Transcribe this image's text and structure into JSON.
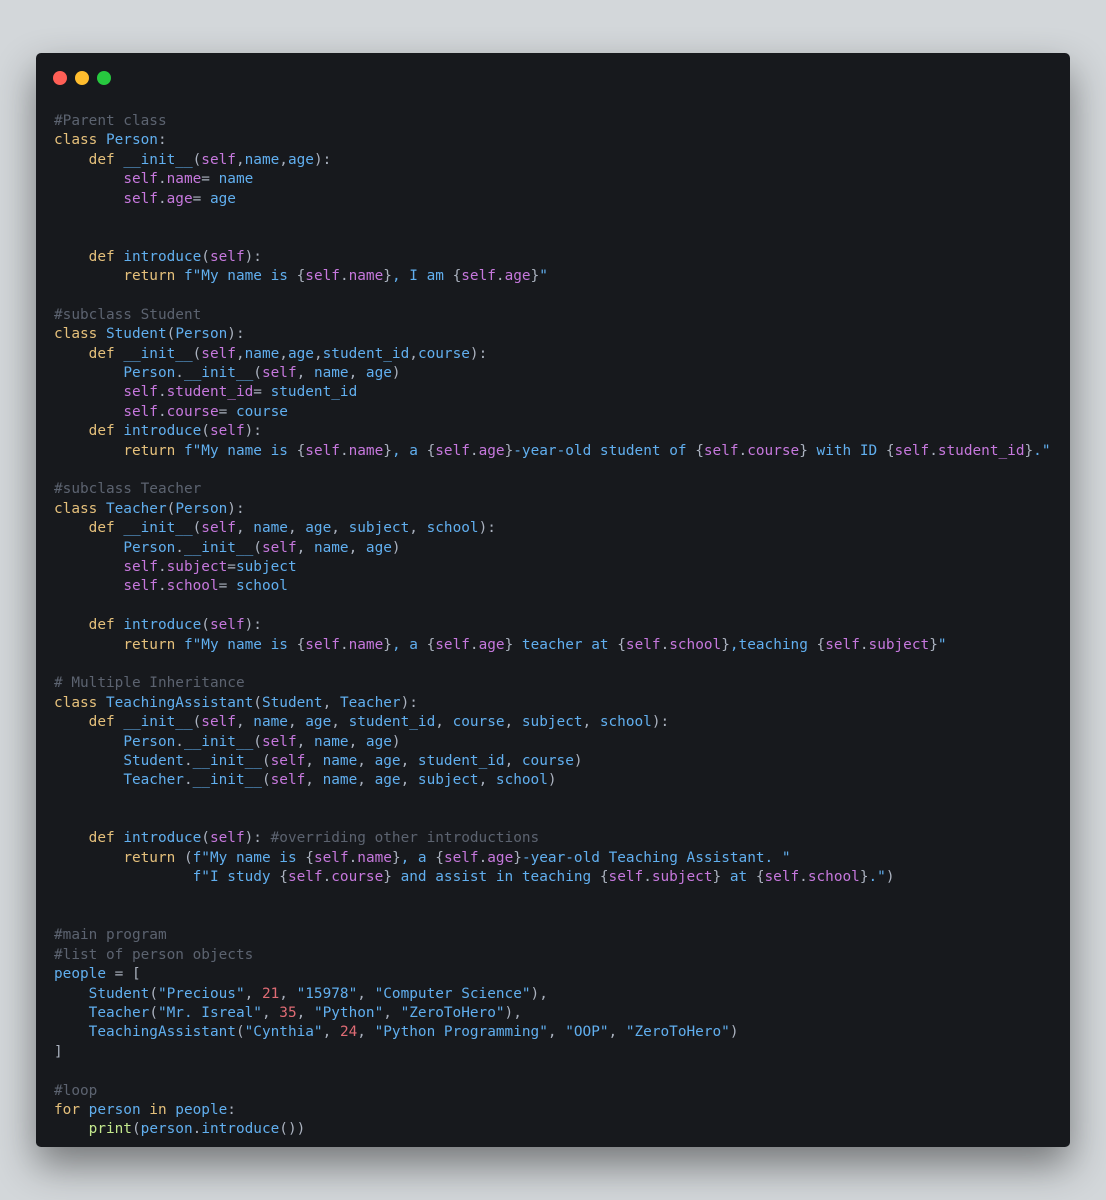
{
  "colors": {
    "background": "#d3d7da",
    "editor_background": "#17191d",
    "traffic_red": "#ff5f56",
    "traffic_yellow": "#ffbd2e",
    "traffic_green": "#27c93f",
    "comment": "#5c6370",
    "keyword": "#e5c07b",
    "identifier": "#61afef",
    "self": "#c678dd",
    "number": "#e06c75",
    "punctuation": "#abb2bf",
    "builtin": "#c3e88d"
  },
  "window_controls": [
    {
      "name": "close",
      "icon": "red-dot-icon"
    },
    {
      "name": "minimize",
      "icon": "yellow-dot-icon"
    },
    {
      "name": "maximize",
      "icon": "green-dot-icon"
    }
  ],
  "code_lines": [
    [
      [
        "comment",
        "#Parent class"
      ]
    ],
    [
      [
        "keyword",
        "class "
      ],
      [
        "classname",
        "Person"
      ],
      [
        "punct",
        ":"
      ]
    ],
    [
      [
        "plain",
        "    "
      ],
      [
        "keyword",
        "def "
      ],
      [
        "func",
        "__init__"
      ],
      [
        "punct",
        "("
      ],
      [
        "self",
        "self"
      ],
      [
        "punct",
        ","
      ],
      [
        "param",
        "name"
      ],
      [
        "punct",
        ","
      ],
      [
        "param",
        "age"
      ],
      [
        "punct",
        "):"
      ]
    ],
    [
      [
        "plain",
        "        "
      ],
      [
        "self",
        "self"
      ],
      [
        "punct",
        "."
      ],
      [
        "self",
        "name"
      ],
      [
        "punct",
        "= "
      ],
      [
        "param",
        "name"
      ]
    ],
    [
      [
        "plain",
        "        "
      ],
      [
        "self",
        "self"
      ],
      [
        "punct",
        "."
      ],
      [
        "self",
        "age"
      ],
      [
        "punct",
        "= "
      ],
      [
        "param",
        "age"
      ]
    ],
    [],
    [],
    [
      [
        "plain",
        "    "
      ],
      [
        "keyword",
        "def "
      ],
      [
        "func",
        "introduce"
      ],
      [
        "punct",
        "("
      ],
      [
        "self",
        "self"
      ],
      [
        "punct",
        "):"
      ]
    ],
    [
      [
        "plain",
        "        "
      ],
      [
        "keyword",
        "return "
      ],
      [
        "string",
        "f\"My name is "
      ],
      [
        "punct",
        "{"
      ],
      [
        "self",
        "self"
      ],
      [
        "punct",
        "."
      ],
      [
        "self",
        "name"
      ],
      [
        "punct",
        "}"
      ],
      [
        "string",
        ", I am "
      ],
      [
        "punct",
        "{"
      ],
      [
        "self",
        "self"
      ],
      [
        "punct",
        "."
      ],
      [
        "self",
        "age"
      ],
      [
        "punct",
        "}"
      ],
      [
        "string",
        "\""
      ]
    ],
    [],
    [
      [
        "comment",
        "#subclass Student"
      ]
    ],
    [
      [
        "keyword",
        "class "
      ],
      [
        "classname",
        "Student"
      ],
      [
        "punct",
        "("
      ],
      [
        "classname",
        "Person"
      ],
      [
        "punct",
        "):"
      ]
    ],
    [
      [
        "plain",
        "    "
      ],
      [
        "keyword",
        "def "
      ],
      [
        "func",
        "__init__"
      ],
      [
        "punct",
        "("
      ],
      [
        "self",
        "self"
      ],
      [
        "punct",
        ","
      ],
      [
        "param",
        "name"
      ],
      [
        "punct",
        ","
      ],
      [
        "param",
        "age"
      ],
      [
        "punct",
        ","
      ],
      [
        "param",
        "student_id"
      ],
      [
        "punct",
        ","
      ],
      [
        "param",
        "course"
      ],
      [
        "punct",
        "):"
      ]
    ],
    [
      [
        "plain",
        "        "
      ],
      [
        "classname",
        "Person"
      ],
      [
        "punct",
        "."
      ],
      [
        "func",
        "__init__"
      ],
      [
        "punct",
        "("
      ],
      [
        "self",
        "self"
      ],
      [
        "punct",
        ", "
      ],
      [
        "param",
        "name"
      ],
      [
        "punct",
        ", "
      ],
      [
        "param",
        "age"
      ],
      [
        "punct",
        ")"
      ]
    ],
    [
      [
        "plain",
        "        "
      ],
      [
        "self",
        "self"
      ],
      [
        "punct",
        "."
      ],
      [
        "self",
        "student_id"
      ],
      [
        "punct",
        "= "
      ],
      [
        "param",
        "student_id"
      ]
    ],
    [
      [
        "plain",
        "        "
      ],
      [
        "self",
        "self"
      ],
      [
        "punct",
        "."
      ],
      [
        "self",
        "course"
      ],
      [
        "punct",
        "= "
      ],
      [
        "param",
        "course"
      ]
    ],
    [
      [
        "plain",
        "    "
      ],
      [
        "keyword",
        "def "
      ],
      [
        "func",
        "introduce"
      ],
      [
        "punct",
        "("
      ],
      [
        "self",
        "self"
      ],
      [
        "punct",
        "):"
      ]
    ],
    [
      [
        "plain",
        "        "
      ],
      [
        "keyword",
        "return "
      ],
      [
        "string",
        "f\"My name is "
      ],
      [
        "punct",
        "{"
      ],
      [
        "self",
        "self"
      ],
      [
        "punct",
        "."
      ],
      [
        "self",
        "name"
      ],
      [
        "punct",
        "}"
      ],
      [
        "string",
        ", a "
      ],
      [
        "punct",
        "{"
      ],
      [
        "self",
        "self"
      ],
      [
        "punct",
        "."
      ],
      [
        "self",
        "age"
      ],
      [
        "punct",
        "}"
      ],
      [
        "string",
        "-year-old student of "
      ],
      [
        "punct",
        "{"
      ],
      [
        "self",
        "self"
      ],
      [
        "punct",
        "."
      ],
      [
        "self",
        "course"
      ],
      [
        "punct",
        "}"
      ],
      [
        "string",
        " with ID "
      ],
      [
        "punct",
        "{"
      ],
      [
        "self",
        "self"
      ],
      [
        "punct",
        "."
      ],
      [
        "self",
        "student_id"
      ],
      [
        "punct",
        "}"
      ],
      [
        "string",
        ".\""
      ]
    ],
    [],
    [
      [
        "comment",
        "#subclass Teacher"
      ]
    ],
    [
      [
        "keyword",
        "class "
      ],
      [
        "classname",
        "Teacher"
      ],
      [
        "punct",
        "("
      ],
      [
        "classname",
        "Person"
      ],
      [
        "punct",
        "):"
      ]
    ],
    [
      [
        "plain",
        "    "
      ],
      [
        "keyword",
        "def "
      ],
      [
        "func",
        "__init__"
      ],
      [
        "punct",
        "("
      ],
      [
        "self",
        "self"
      ],
      [
        "punct",
        ", "
      ],
      [
        "param",
        "name"
      ],
      [
        "punct",
        ", "
      ],
      [
        "param",
        "age"
      ],
      [
        "punct",
        ", "
      ],
      [
        "param",
        "subject"
      ],
      [
        "punct",
        ", "
      ],
      [
        "param",
        "school"
      ],
      [
        "punct",
        "):"
      ]
    ],
    [
      [
        "plain",
        "        "
      ],
      [
        "classname",
        "Person"
      ],
      [
        "punct",
        "."
      ],
      [
        "func",
        "__init__"
      ],
      [
        "punct",
        "("
      ],
      [
        "self",
        "self"
      ],
      [
        "punct",
        ", "
      ],
      [
        "param",
        "name"
      ],
      [
        "punct",
        ", "
      ],
      [
        "param",
        "age"
      ],
      [
        "punct",
        ")"
      ]
    ],
    [
      [
        "plain",
        "        "
      ],
      [
        "self",
        "self"
      ],
      [
        "punct",
        "."
      ],
      [
        "self",
        "subject"
      ],
      [
        "punct",
        "="
      ],
      [
        "param",
        "subject"
      ]
    ],
    [
      [
        "plain",
        "        "
      ],
      [
        "self",
        "self"
      ],
      [
        "punct",
        "."
      ],
      [
        "self",
        "school"
      ],
      [
        "punct",
        "= "
      ],
      [
        "param",
        "school"
      ]
    ],
    [],
    [
      [
        "plain",
        "    "
      ],
      [
        "keyword",
        "def "
      ],
      [
        "func",
        "introduce"
      ],
      [
        "punct",
        "("
      ],
      [
        "self",
        "self"
      ],
      [
        "punct",
        "):"
      ]
    ],
    [
      [
        "plain",
        "        "
      ],
      [
        "keyword",
        "return "
      ],
      [
        "string",
        "f\"My name is "
      ],
      [
        "punct",
        "{"
      ],
      [
        "self",
        "self"
      ],
      [
        "punct",
        "."
      ],
      [
        "self",
        "name"
      ],
      [
        "punct",
        "}"
      ],
      [
        "string",
        ", a "
      ],
      [
        "punct",
        "{"
      ],
      [
        "self",
        "self"
      ],
      [
        "punct",
        "."
      ],
      [
        "self",
        "age"
      ],
      [
        "punct",
        "}"
      ],
      [
        "string",
        " teacher at "
      ],
      [
        "punct",
        "{"
      ],
      [
        "self",
        "self"
      ],
      [
        "punct",
        "."
      ],
      [
        "self",
        "school"
      ],
      [
        "punct",
        "}"
      ],
      [
        "string",
        ",teaching "
      ],
      [
        "punct",
        "{"
      ],
      [
        "self",
        "self"
      ],
      [
        "punct",
        "."
      ],
      [
        "self",
        "subject"
      ],
      [
        "punct",
        "}"
      ],
      [
        "string",
        "\""
      ]
    ],
    [],
    [
      [
        "comment",
        "# Multiple Inheritance"
      ]
    ],
    [
      [
        "keyword",
        "class "
      ],
      [
        "classname",
        "TeachingAssistant"
      ],
      [
        "punct",
        "("
      ],
      [
        "classname",
        "Student"
      ],
      [
        "punct",
        ", "
      ],
      [
        "classname",
        "Teacher"
      ],
      [
        "punct",
        "):"
      ]
    ],
    [
      [
        "plain",
        "    "
      ],
      [
        "keyword",
        "def "
      ],
      [
        "func",
        "__init__"
      ],
      [
        "punct",
        "("
      ],
      [
        "self",
        "self"
      ],
      [
        "punct",
        ", "
      ],
      [
        "param",
        "name"
      ],
      [
        "punct",
        ", "
      ],
      [
        "param",
        "age"
      ],
      [
        "punct",
        ", "
      ],
      [
        "param",
        "student_id"
      ],
      [
        "punct",
        ", "
      ],
      [
        "param",
        "course"
      ],
      [
        "punct",
        ", "
      ],
      [
        "param",
        "subject"
      ],
      [
        "punct",
        ", "
      ],
      [
        "param",
        "school"
      ],
      [
        "punct",
        "):"
      ]
    ],
    [
      [
        "plain",
        "        "
      ],
      [
        "classname",
        "Person"
      ],
      [
        "punct",
        "."
      ],
      [
        "func",
        "__init__"
      ],
      [
        "punct",
        "("
      ],
      [
        "self",
        "self"
      ],
      [
        "punct",
        ", "
      ],
      [
        "param",
        "name"
      ],
      [
        "punct",
        ", "
      ],
      [
        "param",
        "age"
      ],
      [
        "punct",
        ")"
      ]
    ],
    [
      [
        "plain",
        "        "
      ],
      [
        "classname",
        "Student"
      ],
      [
        "punct",
        "."
      ],
      [
        "func",
        "__init__"
      ],
      [
        "punct",
        "("
      ],
      [
        "self",
        "self"
      ],
      [
        "punct",
        ", "
      ],
      [
        "param",
        "name"
      ],
      [
        "punct",
        ", "
      ],
      [
        "param",
        "age"
      ],
      [
        "punct",
        ", "
      ],
      [
        "param",
        "student_id"
      ],
      [
        "punct",
        ", "
      ],
      [
        "param",
        "course"
      ],
      [
        "punct",
        ")"
      ]
    ],
    [
      [
        "plain",
        "        "
      ],
      [
        "classname",
        "Teacher"
      ],
      [
        "punct",
        "."
      ],
      [
        "func",
        "__init__"
      ],
      [
        "punct",
        "("
      ],
      [
        "self",
        "self"
      ],
      [
        "punct",
        ", "
      ],
      [
        "param",
        "name"
      ],
      [
        "punct",
        ", "
      ],
      [
        "param",
        "age"
      ],
      [
        "punct",
        ", "
      ],
      [
        "param",
        "subject"
      ],
      [
        "punct",
        ", "
      ],
      [
        "param",
        "school"
      ],
      [
        "punct",
        ")"
      ]
    ],
    [],
    [],
    [
      [
        "plain",
        "    "
      ],
      [
        "keyword",
        "def "
      ],
      [
        "func",
        "introduce"
      ],
      [
        "punct",
        "("
      ],
      [
        "self",
        "self"
      ],
      [
        "punct",
        "): "
      ],
      [
        "comment",
        "#overriding other introductions"
      ]
    ],
    [
      [
        "plain",
        "        "
      ],
      [
        "keyword",
        "return "
      ],
      [
        "punct",
        "("
      ],
      [
        "string",
        "f\"My name is "
      ],
      [
        "punct",
        "{"
      ],
      [
        "self",
        "self"
      ],
      [
        "punct",
        "."
      ],
      [
        "self",
        "name"
      ],
      [
        "punct",
        "}"
      ],
      [
        "string",
        ", a "
      ],
      [
        "punct",
        "{"
      ],
      [
        "self",
        "self"
      ],
      [
        "punct",
        "."
      ],
      [
        "self",
        "age"
      ],
      [
        "punct",
        "}"
      ],
      [
        "string",
        "-year-old Teaching Assistant. \""
      ]
    ],
    [
      [
        "plain",
        "                "
      ],
      [
        "string",
        "f\"I study "
      ],
      [
        "punct",
        "{"
      ],
      [
        "self",
        "self"
      ],
      [
        "punct",
        "."
      ],
      [
        "self",
        "course"
      ],
      [
        "punct",
        "}"
      ],
      [
        "string",
        " and assist in teaching "
      ],
      [
        "punct",
        "{"
      ],
      [
        "self",
        "self"
      ],
      [
        "punct",
        "."
      ],
      [
        "self",
        "subject"
      ],
      [
        "punct",
        "}"
      ],
      [
        "string",
        " at "
      ],
      [
        "punct",
        "{"
      ],
      [
        "self",
        "self"
      ],
      [
        "punct",
        "."
      ],
      [
        "self",
        "school"
      ],
      [
        "punct",
        "}"
      ],
      [
        "string",
        ".\""
      ],
      [
        "punct",
        ")"
      ]
    ],
    [],
    [],
    [
      [
        "comment",
        "#main program"
      ]
    ],
    [
      [
        "comment",
        "#list of person objects"
      ]
    ],
    [
      [
        "param",
        "people"
      ],
      [
        "punct",
        " = ["
      ]
    ],
    [
      [
        "plain",
        "    "
      ],
      [
        "classname",
        "Student"
      ],
      [
        "punct",
        "("
      ],
      [
        "string",
        "\"Precious\""
      ],
      [
        "punct",
        ", "
      ],
      [
        "number",
        "21"
      ],
      [
        "punct",
        ", "
      ],
      [
        "string",
        "\"15978\""
      ],
      [
        "punct",
        ", "
      ],
      [
        "string",
        "\"Computer Science\""
      ],
      [
        "punct",
        "),"
      ]
    ],
    [
      [
        "plain",
        "    "
      ],
      [
        "classname",
        "Teacher"
      ],
      [
        "punct",
        "("
      ],
      [
        "string",
        "\"Mr. Isreal\""
      ],
      [
        "punct",
        ", "
      ],
      [
        "number",
        "35"
      ],
      [
        "punct",
        ", "
      ],
      [
        "string",
        "\"Python\""
      ],
      [
        "punct",
        ", "
      ],
      [
        "string",
        "\"ZeroToHero\""
      ],
      [
        "punct",
        "),"
      ]
    ],
    [
      [
        "plain",
        "    "
      ],
      [
        "classname",
        "TeachingAssistant"
      ],
      [
        "punct",
        "("
      ],
      [
        "string",
        "\"Cynthia\""
      ],
      [
        "punct",
        ", "
      ],
      [
        "number",
        "24"
      ],
      [
        "punct",
        ", "
      ],
      [
        "string",
        "\"Python Programming\""
      ],
      [
        "punct",
        ", "
      ],
      [
        "string",
        "\"OOP\""
      ],
      [
        "punct",
        ", "
      ],
      [
        "string",
        "\"ZeroToHero\""
      ],
      [
        "punct",
        ")"
      ]
    ],
    [
      [
        "punct",
        "]"
      ]
    ],
    [],
    [
      [
        "comment",
        "#loop"
      ]
    ],
    [
      [
        "keyword",
        "for "
      ],
      [
        "param",
        "person"
      ],
      [
        "keyword",
        " in "
      ],
      [
        "param",
        "people"
      ],
      [
        "punct",
        ":"
      ]
    ],
    [
      [
        "plain",
        "    "
      ],
      [
        "builtin",
        "print"
      ],
      [
        "punct",
        "("
      ],
      [
        "param",
        "person"
      ],
      [
        "punct",
        "."
      ],
      [
        "func",
        "introduce"
      ],
      [
        "punct",
        "())"
      ]
    ]
  ]
}
